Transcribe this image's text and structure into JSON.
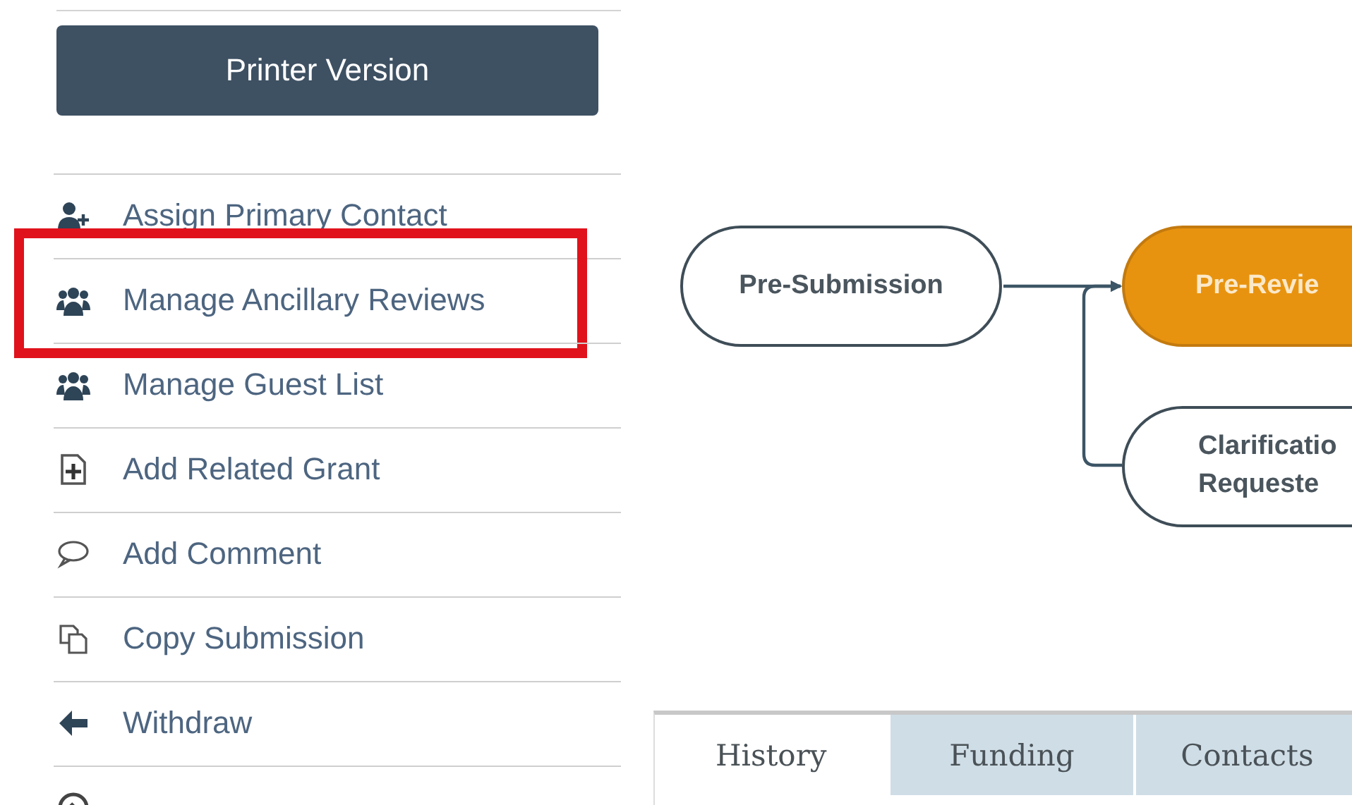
{
  "sidebar": {
    "printer_button": "Printer Version",
    "items": [
      {
        "label": "Assign Primary Contact",
        "kind": "user-plus",
        "highlighted": false
      },
      {
        "label": "Manage Ancillary Reviews",
        "kind": "users",
        "highlighted": true
      },
      {
        "label": "Manage Guest List",
        "kind": "users",
        "highlighted": false
      },
      {
        "label": "Add Related Grant",
        "kind": "file-plus",
        "highlighted": false
      },
      {
        "label": "Add Comment",
        "kind": "comment",
        "highlighted": false
      },
      {
        "label": "Copy Submission",
        "kind": "copy",
        "highlighted": false
      },
      {
        "label": "Withdraw",
        "kind": "arrow-left",
        "highlighted": false
      },
      {
        "kind": "discard",
        "highlighted": false
      }
    ]
  },
  "workflow": {
    "nodes": [
      {
        "label": "Pre-Submission",
        "selected": false
      },
      {
        "label": "Pre-Revie",
        "selected": true
      },
      {
        "label": "Clarificatio Requeste",
        "selected": false
      }
    ]
  },
  "tabs": [
    {
      "label": "History",
      "selected": true
    },
    {
      "label": "Funding",
      "selected": false
    },
    {
      "label": "Contacts",
      "selected": false
    }
  ]
}
